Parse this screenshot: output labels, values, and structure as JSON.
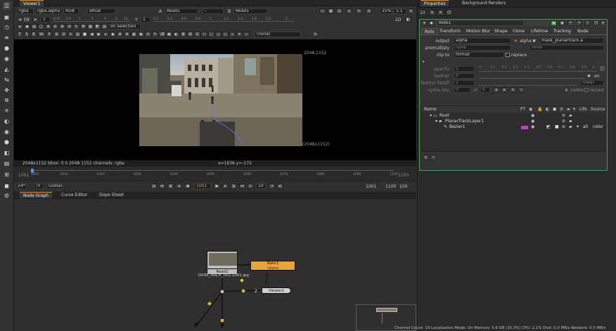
{
  "viewer": {
    "tab": "Viewer1",
    "channels": "rgba",
    "layer": "rgba.alpha",
    "display": "RGB",
    "colorspace": "sRGB",
    "input_a": "A",
    "node_a": "Read1",
    "dash": "-",
    "input_b": "B",
    "node_b": "Read1",
    "zoom": "25%",
    "ratio": "1:1",
    "view_mode": "2D",
    "fstop": "f/8",
    "gain": "1",
    "y_label": "Y",
    "gamma": "1",
    "on_selection": "on selection",
    "none_dropdown": "(none)",
    "format_top": "2048,1152",
    "format_bottom": "(2048x1152)",
    "info_left": "2048x1152  bbox: 0 0 2048 1152 channels: rgba",
    "info_coords": "x=1636 y=-172",
    "tools": [
      "T",
      "S",
      "R",
      "Sh",
      "P"
    ],
    "gain_ticks": [
      "0.25",
      "0.5",
      "1",
      "2",
      "4",
      "8",
      "16"
    ],
    "gamma_ticks": [
      "0.2",
      "0.4",
      "0.6",
      "0.8",
      "1",
      "1.2",
      "1.4",
      "1.6",
      "1.8",
      "2"
    ]
  },
  "timeline": {
    "start": "1001",
    "end": "1100",
    "ticks": [
      "1001",
      "1010",
      "1020",
      "1030",
      "1040",
      "1050",
      "1060",
      "1070",
      "1080",
      "1090",
      "1100"
    ],
    "fps": "24*",
    "tf": "TF",
    "range_mode": "Global",
    "current_frame": "1001",
    "step": "10",
    "in_frame": "1001",
    "out_frame": "1100",
    "loop_count": "100",
    "current_position": 0
  },
  "nodegraph": {
    "tabs": [
      "Node Graph",
      "Curve Editor",
      "Dope Sheet"
    ],
    "read_node": "Read1",
    "read_file": "D036_ARCH_050.1001.jpg",
    "roto_node": "Roto1",
    "roto_sub": "(alpha mask_planartrack.a)",
    "viewer_node": "Viewer1",
    "pipe_label": "2"
  },
  "properties": {
    "tabs": [
      "Properties",
      "Background Renders"
    ],
    "max_panels": "10",
    "node_name": "Roto1",
    "node_tabs": [
      "Roto",
      "Transform",
      "Motion Blur",
      "Shape",
      "Clone",
      "Lifetime",
      "Tracking",
      "Node"
    ],
    "output_label": "output",
    "output_value": "alpha",
    "mask_channel": "alpha",
    "mask_source": "mask_planartrack.a",
    "premultiply_label": "premultiply",
    "premultiply_value": "none",
    "premult_right": "none",
    "clipto_label": "clip to",
    "clipto_value": "format",
    "replace_label": "replace",
    "opacity_label": "opacity",
    "opacity_value": "1",
    "feather_label": "feather",
    "feather_value": "0",
    "falloff_label": "feather falloff",
    "falloff_value": "1",
    "falloff_type": "linear",
    "on_label": "on",
    "splinekey_label": "spline key",
    "splinekey_value": "0",
    "of_label": "of",
    "of_value": "0",
    "visible_label": "visible",
    "locked_label": "locked",
    "opacity_ticks": [
      "0",
      "0.1",
      "0.2",
      "0.3",
      "0.4",
      "0.5",
      "0.6",
      "0.7",
      "0.8",
      "0.9",
      "1"
    ],
    "tree_headers": [
      "Name",
      "PT",
      "Life",
      "Source"
    ],
    "tree": [
      {
        "name": "Root",
        "level": 0,
        "life": "",
        "source": ""
      },
      {
        "name": "PlanarTrackLayer1",
        "level": 1,
        "life": "",
        "source": ""
      },
      {
        "name": "Bezier1",
        "level": 2,
        "life": "all",
        "source": "color"
      }
    ],
    "add_btn": "+",
    "remove_btn": "−"
  },
  "status": {
    "text": "Channel Count: 19  Localization Mode: On  Memory: 5.6 GB (35.3%)  CPU: 2.1%  Disk: 0.0 MB/s  Network: 0.0 MB/s"
  },
  "colors": {
    "accent": "#e38a1c",
    "roto_green": "#3aa14a",
    "roto_node": "#e8a33a",
    "bezier_pink": "#c43fc4"
  }
}
